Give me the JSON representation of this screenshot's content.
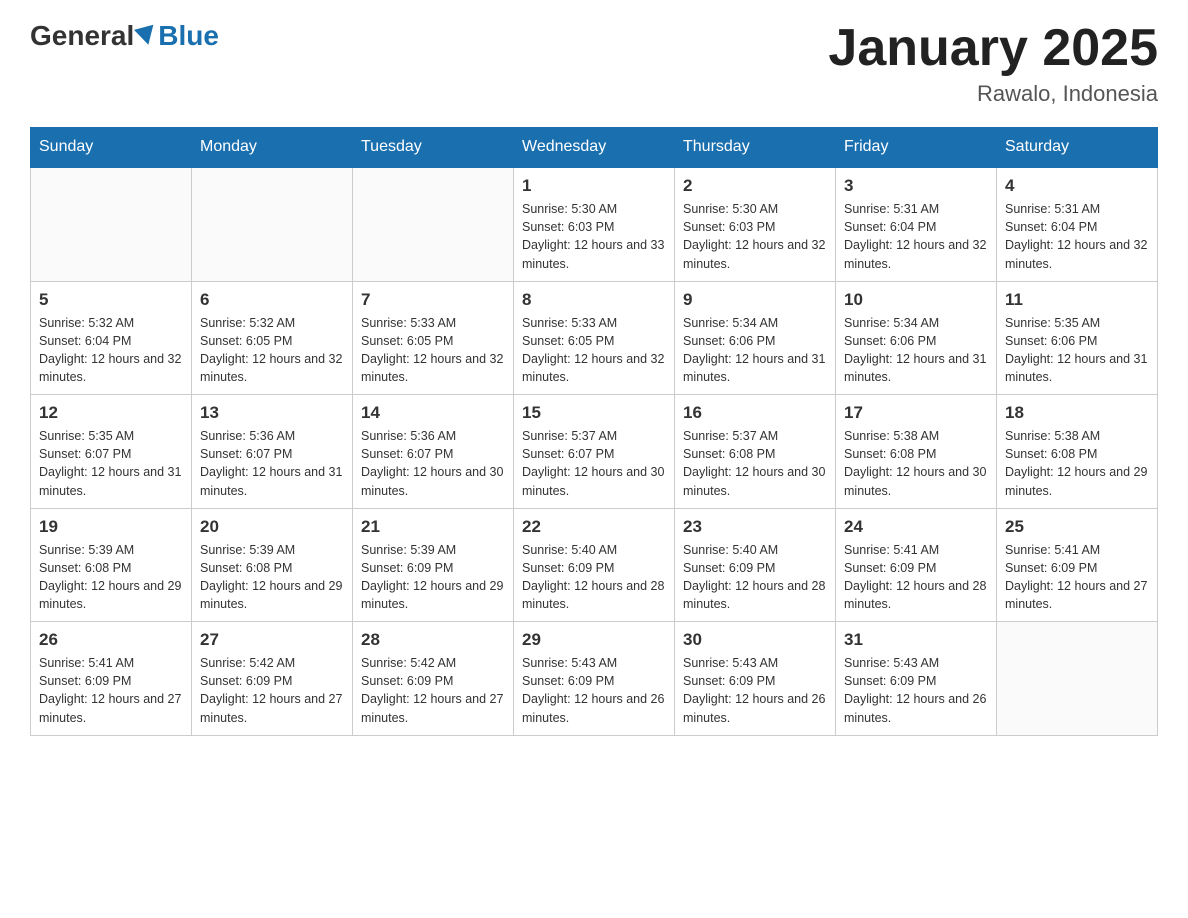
{
  "header": {
    "logo_general": "General",
    "logo_blue": "Blue",
    "title": "January 2025",
    "subtitle": "Rawalo, Indonesia"
  },
  "days_of_week": [
    "Sunday",
    "Monday",
    "Tuesday",
    "Wednesday",
    "Thursday",
    "Friday",
    "Saturday"
  ],
  "weeks": [
    [
      {
        "day": "",
        "empty": true
      },
      {
        "day": "",
        "empty": true
      },
      {
        "day": "",
        "empty": true
      },
      {
        "day": "1",
        "sunrise": "Sunrise: 5:30 AM",
        "sunset": "Sunset: 6:03 PM",
        "daylight": "Daylight: 12 hours and 33 minutes."
      },
      {
        "day": "2",
        "sunrise": "Sunrise: 5:30 AM",
        "sunset": "Sunset: 6:03 PM",
        "daylight": "Daylight: 12 hours and 32 minutes."
      },
      {
        "day": "3",
        "sunrise": "Sunrise: 5:31 AM",
        "sunset": "Sunset: 6:04 PM",
        "daylight": "Daylight: 12 hours and 32 minutes."
      },
      {
        "day": "4",
        "sunrise": "Sunrise: 5:31 AM",
        "sunset": "Sunset: 6:04 PM",
        "daylight": "Daylight: 12 hours and 32 minutes."
      }
    ],
    [
      {
        "day": "5",
        "sunrise": "Sunrise: 5:32 AM",
        "sunset": "Sunset: 6:04 PM",
        "daylight": "Daylight: 12 hours and 32 minutes."
      },
      {
        "day": "6",
        "sunrise": "Sunrise: 5:32 AM",
        "sunset": "Sunset: 6:05 PM",
        "daylight": "Daylight: 12 hours and 32 minutes."
      },
      {
        "day": "7",
        "sunrise": "Sunrise: 5:33 AM",
        "sunset": "Sunset: 6:05 PM",
        "daylight": "Daylight: 12 hours and 32 minutes."
      },
      {
        "day": "8",
        "sunrise": "Sunrise: 5:33 AM",
        "sunset": "Sunset: 6:05 PM",
        "daylight": "Daylight: 12 hours and 32 minutes."
      },
      {
        "day": "9",
        "sunrise": "Sunrise: 5:34 AM",
        "sunset": "Sunset: 6:06 PM",
        "daylight": "Daylight: 12 hours and 31 minutes."
      },
      {
        "day": "10",
        "sunrise": "Sunrise: 5:34 AM",
        "sunset": "Sunset: 6:06 PM",
        "daylight": "Daylight: 12 hours and 31 minutes."
      },
      {
        "day": "11",
        "sunrise": "Sunrise: 5:35 AM",
        "sunset": "Sunset: 6:06 PM",
        "daylight": "Daylight: 12 hours and 31 minutes."
      }
    ],
    [
      {
        "day": "12",
        "sunrise": "Sunrise: 5:35 AM",
        "sunset": "Sunset: 6:07 PM",
        "daylight": "Daylight: 12 hours and 31 minutes."
      },
      {
        "day": "13",
        "sunrise": "Sunrise: 5:36 AM",
        "sunset": "Sunset: 6:07 PM",
        "daylight": "Daylight: 12 hours and 31 minutes."
      },
      {
        "day": "14",
        "sunrise": "Sunrise: 5:36 AM",
        "sunset": "Sunset: 6:07 PM",
        "daylight": "Daylight: 12 hours and 30 minutes."
      },
      {
        "day": "15",
        "sunrise": "Sunrise: 5:37 AM",
        "sunset": "Sunset: 6:07 PM",
        "daylight": "Daylight: 12 hours and 30 minutes."
      },
      {
        "day": "16",
        "sunrise": "Sunrise: 5:37 AM",
        "sunset": "Sunset: 6:08 PM",
        "daylight": "Daylight: 12 hours and 30 minutes."
      },
      {
        "day": "17",
        "sunrise": "Sunrise: 5:38 AM",
        "sunset": "Sunset: 6:08 PM",
        "daylight": "Daylight: 12 hours and 30 minutes."
      },
      {
        "day": "18",
        "sunrise": "Sunrise: 5:38 AM",
        "sunset": "Sunset: 6:08 PM",
        "daylight": "Daylight: 12 hours and 29 minutes."
      }
    ],
    [
      {
        "day": "19",
        "sunrise": "Sunrise: 5:39 AM",
        "sunset": "Sunset: 6:08 PM",
        "daylight": "Daylight: 12 hours and 29 minutes."
      },
      {
        "day": "20",
        "sunrise": "Sunrise: 5:39 AM",
        "sunset": "Sunset: 6:08 PM",
        "daylight": "Daylight: 12 hours and 29 minutes."
      },
      {
        "day": "21",
        "sunrise": "Sunrise: 5:39 AM",
        "sunset": "Sunset: 6:09 PM",
        "daylight": "Daylight: 12 hours and 29 minutes."
      },
      {
        "day": "22",
        "sunrise": "Sunrise: 5:40 AM",
        "sunset": "Sunset: 6:09 PM",
        "daylight": "Daylight: 12 hours and 28 minutes."
      },
      {
        "day": "23",
        "sunrise": "Sunrise: 5:40 AM",
        "sunset": "Sunset: 6:09 PM",
        "daylight": "Daylight: 12 hours and 28 minutes."
      },
      {
        "day": "24",
        "sunrise": "Sunrise: 5:41 AM",
        "sunset": "Sunset: 6:09 PM",
        "daylight": "Daylight: 12 hours and 28 minutes."
      },
      {
        "day": "25",
        "sunrise": "Sunrise: 5:41 AM",
        "sunset": "Sunset: 6:09 PM",
        "daylight": "Daylight: 12 hours and 27 minutes."
      }
    ],
    [
      {
        "day": "26",
        "sunrise": "Sunrise: 5:41 AM",
        "sunset": "Sunset: 6:09 PM",
        "daylight": "Daylight: 12 hours and 27 minutes."
      },
      {
        "day": "27",
        "sunrise": "Sunrise: 5:42 AM",
        "sunset": "Sunset: 6:09 PM",
        "daylight": "Daylight: 12 hours and 27 minutes."
      },
      {
        "day": "28",
        "sunrise": "Sunrise: 5:42 AM",
        "sunset": "Sunset: 6:09 PM",
        "daylight": "Daylight: 12 hours and 27 minutes."
      },
      {
        "day": "29",
        "sunrise": "Sunrise: 5:43 AM",
        "sunset": "Sunset: 6:09 PM",
        "daylight": "Daylight: 12 hours and 26 minutes."
      },
      {
        "day": "30",
        "sunrise": "Sunrise: 5:43 AM",
        "sunset": "Sunset: 6:09 PM",
        "daylight": "Daylight: 12 hours and 26 minutes."
      },
      {
        "day": "31",
        "sunrise": "Sunrise: 5:43 AM",
        "sunset": "Sunset: 6:09 PM",
        "daylight": "Daylight: 12 hours and 26 minutes."
      },
      {
        "day": "",
        "empty": true
      }
    ]
  ]
}
